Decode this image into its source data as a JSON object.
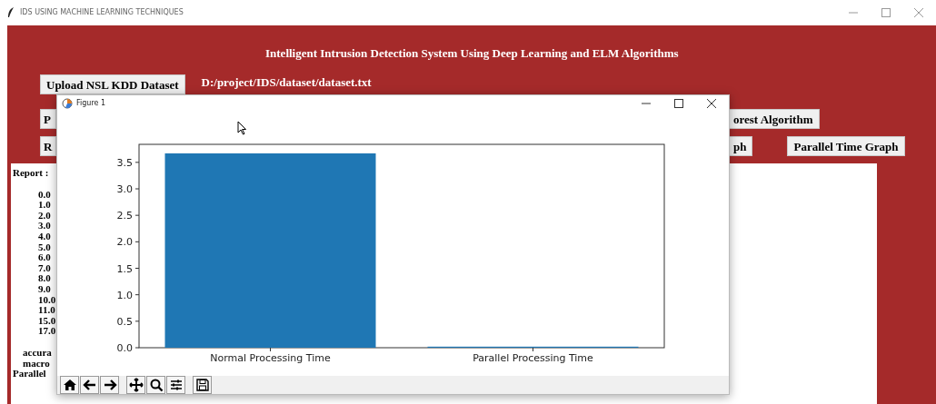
{
  "window": {
    "title": "IDS USING MACHINE LEARNING TECHNIQUES"
  },
  "app": {
    "heading": "Intelligent Intrusion Detection System Using Deep Learning and ELM Algorithms",
    "button_rows": [
      {
        "left": "Upload NSL KDD Dataset",
        "path": "D:/project/IDS/dataset/dataset.txt",
        "right": []
      },
      {
        "left": "P",
        "right": [
          "orest Algorithm"
        ]
      },
      {
        "left": "R",
        "right": [
          "ph",
          "Parallel Time Graph"
        ]
      }
    ],
    "report": [
      {
        "kind": "heading",
        "text": "Report :"
      },
      {
        "kind": "class",
        "text": "0.0"
      },
      {
        "kind": "class",
        "text": "1.0"
      },
      {
        "kind": "class",
        "text": "2.0"
      },
      {
        "kind": "class",
        "text": "3.0"
      },
      {
        "kind": "class",
        "text": "4.0"
      },
      {
        "kind": "class",
        "text": "5.0"
      },
      {
        "kind": "class",
        "text": "6.0"
      },
      {
        "kind": "class",
        "text": "7.0"
      },
      {
        "kind": "class",
        "text": "8.0"
      },
      {
        "kind": "class",
        "text": "9.0"
      },
      {
        "kind": "class",
        "text": "10.0"
      },
      {
        "kind": "class",
        "text": "11.0"
      },
      {
        "kind": "class",
        "text": "15.0"
      },
      {
        "kind": "class",
        "text": "17.0"
      },
      {
        "kind": "summary",
        "text": "accura"
      },
      {
        "kind": "summary",
        "text": "macro"
      },
      {
        "kind": "footer",
        "text": "Parallel"
      }
    ]
  },
  "figure": {
    "title": "Figure 1",
    "chart_data": {
      "type": "bar",
      "categories": [
        "Normal Processing Time",
        "Parallel Processing Time"
      ],
      "values": [
        3.67,
        0.02
      ],
      "ylim": [
        0,
        3.84
      ],
      "yticks": [
        {
          "value": 0,
          "label": "0.0"
        },
        {
          "value": 0.5,
          "label": "0.5"
        },
        {
          "value": 1,
          "label": "1.0"
        },
        {
          "value": 1.5,
          "label": "1.5"
        },
        {
          "value": 2,
          "label": "2.0"
        },
        {
          "value": 2.5,
          "label": "2.5"
        },
        {
          "value": 3,
          "label": "3.0"
        },
        {
          "value": 3.5,
          "label": "3.5"
        }
      ]
    }
  }
}
